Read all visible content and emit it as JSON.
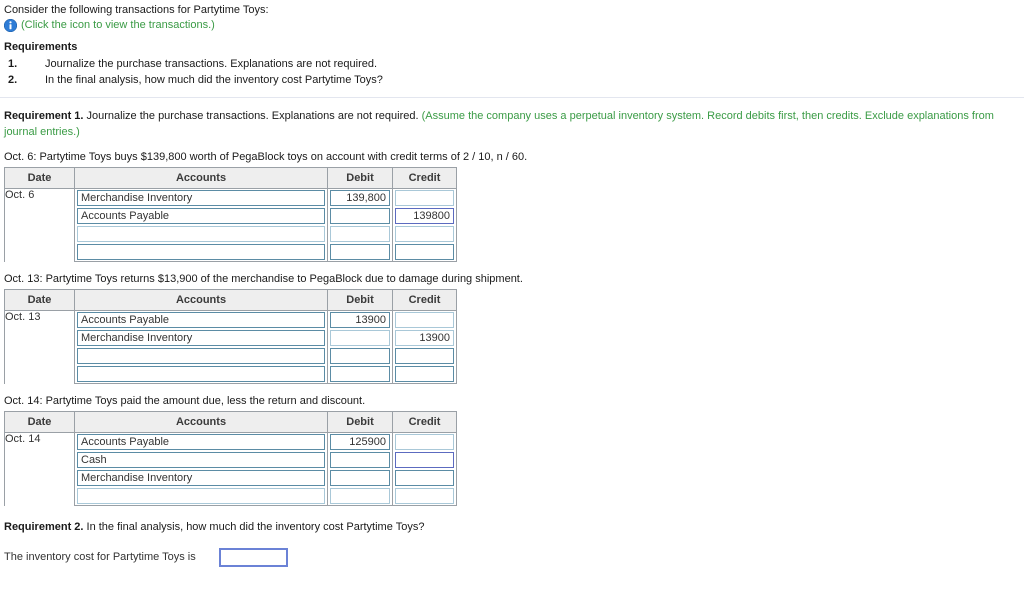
{
  "problem": {
    "prompt": "Consider the following transactions for Partytime Toys:",
    "icon_name": "info-icon",
    "icon_link_text": "(Click the icon to view the transactions.)",
    "requirements_title": "Requirements",
    "requirements": [
      {
        "num": "1.",
        "text": "Journalize the purchase transactions. Explanations are not required."
      },
      {
        "num": "2.",
        "text": "In the final analysis, how much did the inventory cost Partytime Toys?"
      }
    ]
  },
  "requirement1": {
    "label": "Requirement 1.",
    "text": " Journalize the purchase transactions. Explanations are not required. ",
    "hint": "(Assume the company uses a perpetual inventory system. Record debits first, then credits. Exclude explanations from journal entries.)"
  },
  "table_headers": {
    "date": "Date",
    "accounts": "Accounts",
    "debit": "Debit",
    "credit": "Credit"
  },
  "transactions": [
    {
      "caption": "Oct. 6: Partytime Toys buys $139,800 worth of PegaBlock toys on account with credit terms of 2 / 10, n / 60.",
      "date": "Oct. 6",
      "rows": [
        {
          "account": "Merchandise Inventory",
          "debit": "139,800",
          "credit": "",
          "account_state": "filled",
          "debit_state": "filled",
          "credit_state": "empty"
        },
        {
          "account": "Accounts Payable",
          "debit": "",
          "credit": "139800",
          "account_state": "filled",
          "debit_state": "empty",
          "credit_state": "focused"
        },
        {
          "account": "",
          "debit": "",
          "credit": "",
          "account_state": "pale",
          "debit_state": "pale",
          "credit_state": "pale"
        },
        {
          "account": "",
          "debit": "",
          "credit": "",
          "account_state": "empty",
          "debit_state": "empty",
          "credit_state": "empty"
        }
      ]
    },
    {
      "caption": "Oct. 13: Partytime Toys returns $13,900 of the merchandise to PegaBlock due to damage during shipment.",
      "date": "Oct. 13",
      "rows": [
        {
          "account": "Accounts Payable",
          "debit": "13900",
          "credit": "",
          "account_state": "filled",
          "debit_state": "filled",
          "credit_state": "pale"
        },
        {
          "account": "Merchandise Inventory",
          "debit": "",
          "credit": "13900",
          "account_state": "filled",
          "debit_state": "empty",
          "credit_state": "pale"
        },
        {
          "account": "",
          "debit": "",
          "credit": "",
          "account_state": "empty",
          "debit_state": "empty",
          "credit_state": "empty"
        },
        {
          "account": "",
          "debit": "",
          "credit": "",
          "account_state": "empty",
          "debit_state": "empty",
          "credit_state": "empty"
        }
      ]
    },
    {
      "caption": "Oct. 14: Partytime Toys paid the amount due, less the return and discount.",
      "date": "Oct. 14",
      "rows": [
        {
          "account": "Accounts Payable",
          "debit": "125900",
          "credit": "",
          "account_state": "filled",
          "debit_state": "filled",
          "credit_state": "pale"
        },
        {
          "account": "Cash",
          "debit": "",
          "credit": "",
          "account_state": "filled",
          "debit_state": "empty",
          "credit_state": "focused"
        },
        {
          "account": "Merchandise Inventory",
          "debit": "",
          "credit": "",
          "account_state": "filled",
          "debit_state": "empty",
          "credit_state": "empty"
        },
        {
          "account": "",
          "debit": "",
          "credit": "",
          "account_state": "pale",
          "debit_state": "pale",
          "credit_state": "pale"
        }
      ]
    }
  ],
  "requirement2": {
    "label": "Requirement 2.",
    "text": " In the final analysis, how much did the inventory cost Partytime Toys?",
    "answer_label": "The inventory cost for Partytime Toys is",
    "answer_value": "",
    "answer_placeholder": ""
  },
  "colors": {
    "green_text": "#3a9b45",
    "field_border": "#5b8ca5",
    "focus_border": "#5c6bc0",
    "header_bg": "#eeeeee",
    "table_border": "#9aa0a6"
  }
}
